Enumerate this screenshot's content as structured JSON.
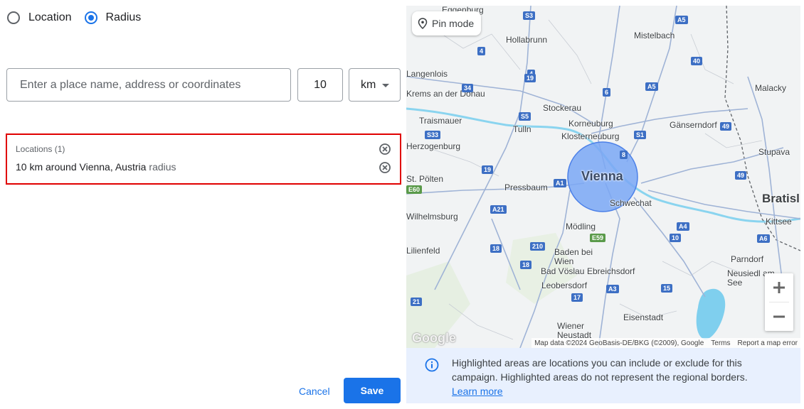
{
  "mode_selector": {
    "options": [
      {
        "label": "Location",
        "selected": false
      },
      {
        "label": "Radius",
        "selected": true
      }
    ]
  },
  "search": {
    "placeholder": "Enter a place name, address or coordinates",
    "value": ""
  },
  "radius": {
    "value": "10"
  },
  "unit": {
    "value": "km",
    "icon": "arrow-drop-down-icon"
  },
  "locations": {
    "title": "Locations (1)",
    "items": [
      {
        "text": "10 km around Vienna, Austria",
        "tag": "radius"
      }
    ]
  },
  "map": {
    "pin_mode_label": "Pin mode",
    "center_city": "Vienna",
    "place_labels": [
      {
        "text": "Eggenburg"
      },
      {
        "text": "Hollabrunn"
      },
      {
        "text": "Mistelbach"
      },
      {
        "text": "Langenlois"
      },
      {
        "text": "Stockerau"
      },
      {
        "text": "Malacky"
      },
      {
        "text": "Traismauer"
      },
      {
        "text": "Korneuburg"
      },
      {
        "text": "Tulln"
      },
      {
        "text": "Klosterneuburg"
      },
      {
        "text": "Gänserndorf"
      },
      {
        "text": "Stupava"
      },
      {
        "text": "Herzogenburg"
      },
      {
        "text": "Pressbaum"
      },
      {
        "text": "Schwechat"
      },
      {
        "text": "St. Pölten"
      },
      {
        "text": "Bratisl"
      },
      {
        "text": "Kittsee"
      },
      {
        "text": "Mödling"
      },
      {
        "text": "Baden bei Wien"
      },
      {
        "text": "Ebreichsdorf"
      },
      {
        "text": "Bad Vöslau"
      },
      {
        "text": "Leobersdorf"
      },
      {
        "text": "Parndorf"
      },
      {
        "text": "Neusiedl am See"
      },
      {
        "text": "Wiener Neustadt"
      },
      {
        "text": "Eisenstadt"
      },
      {
        "text": "Lilienfeld"
      },
      {
        "text": "Wilhelmsburg"
      },
      {
        "text": "Krems an der Donau"
      }
    ],
    "road_shields": [
      "S3",
      "A5",
      "4",
      "4",
      "40",
      "19",
      "34",
      "A5",
      "6",
      "S5",
      "S1",
      "49",
      "S33",
      "8",
      "19",
      "49",
      "A1",
      "E60",
      "A21",
      "A4",
      "A6",
      "E59",
      "10",
      "18",
      "210",
      "18",
      "A3",
      "15",
      "17",
      "21"
    ],
    "zoom_in_icon": "plus-icon",
    "zoom_out_icon": "minus-icon",
    "logo_text": "Google",
    "attribution": "Map data ©2024 GeoBasis-DE/BKG (©2009), Google",
    "terms": "Terms",
    "report": "Report a map error"
  },
  "info": {
    "icon": "info-icon",
    "text": "Highlighted areas are locations you can include or exclude for this campaign. Highlighted areas do not represent the regional borders.",
    "learn_more": "Learn more"
  },
  "actions": {
    "cancel": "Cancel",
    "save": "Save"
  },
  "colors": {
    "accent": "#1a73e8",
    "error_outline": "#e00000",
    "radius_fill": "#7aa7f5",
    "info_bg": "#e8f0fe"
  }
}
